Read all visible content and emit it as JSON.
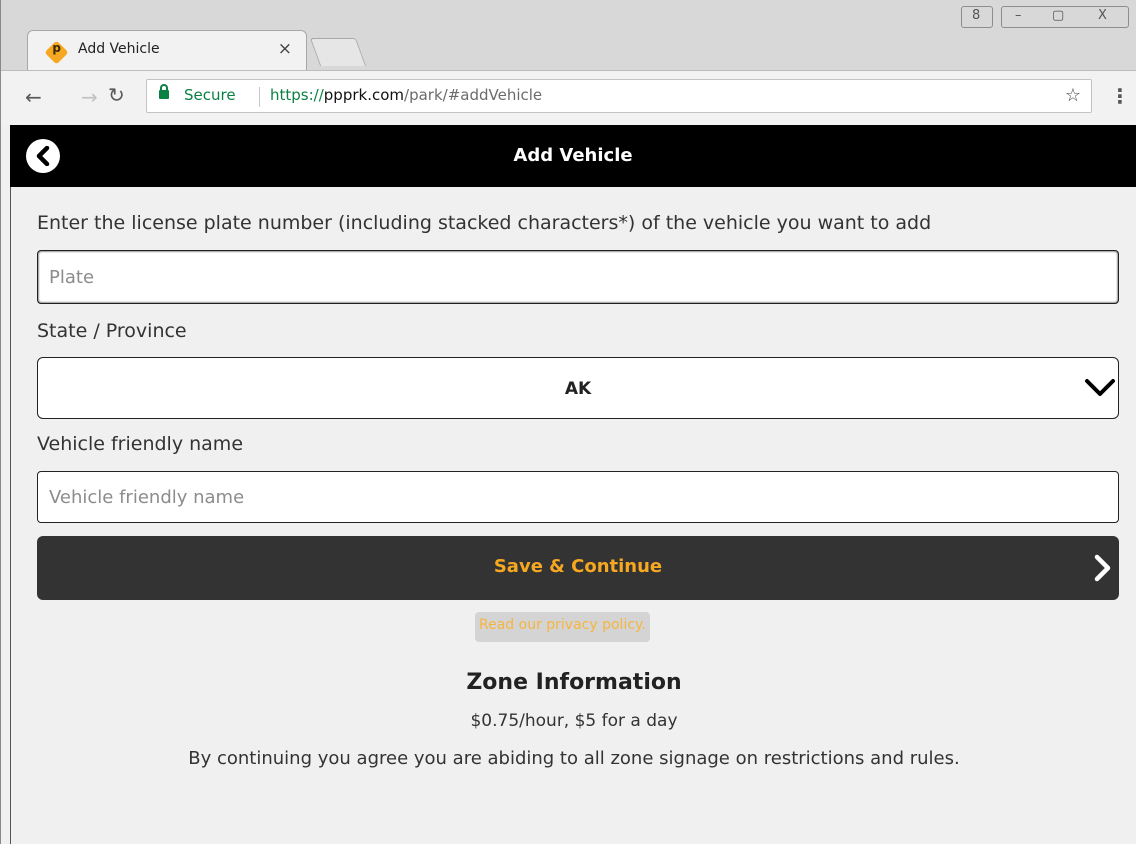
{
  "browser": {
    "tab_title": "Add Vehicle",
    "tab_close": "×",
    "favicon_letter": "p",
    "secure_label": "Secure",
    "url_scheme": "https://",
    "url_host": "ppprk.com",
    "url_path": "/park/#addVehicle",
    "window_controls": {
      "user": "8",
      "minimize": "–",
      "maximize": "▢",
      "close": "X"
    }
  },
  "header": {
    "title": "Add Vehicle"
  },
  "form": {
    "instructions": "Enter the license plate number (including stacked characters*) of the vehicle you want to add",
    "plate": {
      "placeholder": "Plate",
      "value": ""
    },
    "state_label": "State / Province",
    "state_value": "AK",
    "friendly_label": "Vehicle friendly name",
    "friendly": {
      "placeholder": "Vehicle friendly name",
      "value": ""
    },
    "save_label": "Save & Continue",
    "privacy_link": "Read our privacy policy."
  },
  "zone": {
    "heading": "Zone Information",
    "rate": "$0.75/hour, $5 for a day",
    "note": "By continuing you agree you are abiding to all zone signage on restrictions and rules."
  },
  "colors": {
    "accent": "#f6a821",
    "secure": "#0b8043",
    "header_bg": "#000000",
    "button_bg": "#333333"
  },
  "icons": [
    "back-arrow-icon",
    "forward-arrow-icon",
    "reload-icon",
    "lock-icon",
    "star-icon",
    "menu-icon",
    "chevron-left-circle-icon",
    "chevron-down-icon",
    "chevron-right-icon"
  ]
}
